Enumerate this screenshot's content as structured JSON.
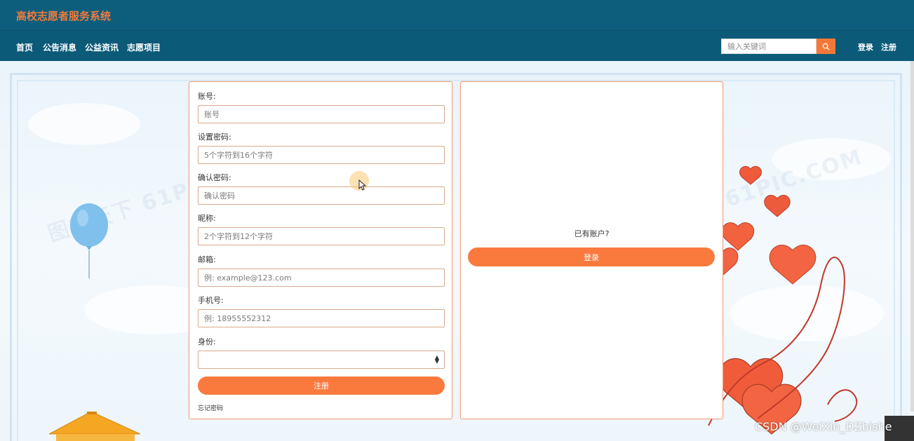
{
  "header": {
    "site_title": "高校志愿者服务系统"
  },
  "nav": {
    "items": [
      {
        "label": "首页"
      },
      {
        "label": "公告消息"
      },
      {
        "label": "公益资讯"
      },
      {
        "label": "志愿项目"
      }
    ],
    "search_placeholder": "输入关键词",
    "login_label": "登录",
    "register_label": "注册"
  },
  "register_form": {
    "fields": [
      {
        "label": "账号:",
        "placeholder": "账号"
      },
      {
        "label": "设置密码:",
        "placeholder": "5个字符到16个字符"
      },
      {
        "label": "确认密码:",
        "placeholder": "确认密码"
      },
      {
        "label": "昵称:",
        "placeholder": "2个字符到12个字符"
      },
      {
        "label": "邮箱:",
        "placeholder": "例: example@123.com"
      },
      {
        "label": "手机号:",
        "placeholder": "例: 18955552312"
      }
    ],
    "identity_label": "身份:",
    "identity_value": "",
    "submit_label": "注册",
    "forgot_label": "忘记密码"
  },
  "side_panel": {
    "has_account_text": "已有账户?",
    "login_button_label": "登录"
  },
  "watermark": "CSDN @WeiXin_DZbishe",
  "colors": {
    "header_bg": "#0c5e7c",
    "nav_bg": "#0b5a78",
    "accent": "#fa7a3e",
    "title": "#f07a3c"
  }
}
